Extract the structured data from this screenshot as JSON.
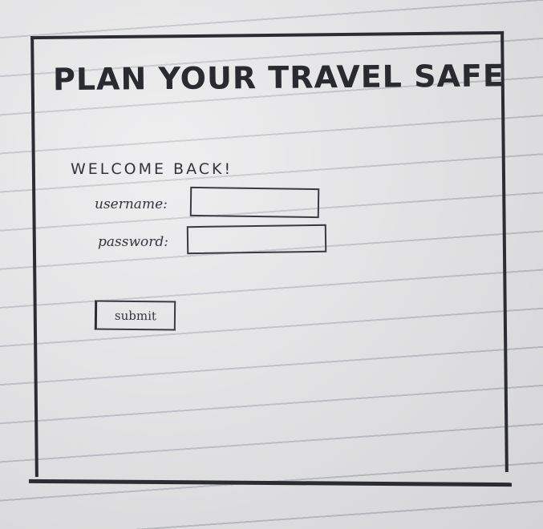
{
  "header": {
    "title": "PLAN YOUR TRAVEL SAFE"
  },
  "login": {
    "welcome": "WELCOME BACK!",
    "username_label": "username:",
    "username_value": "",
    "password_label": "password:",
    "password_value": "",
    "submit_label": "submit"
  },
  "colors": {
    "ink": "#2c2d33",
    "paper": "#e6e6e8",
    "rule_line": "#b9bcc2"
  }
}
